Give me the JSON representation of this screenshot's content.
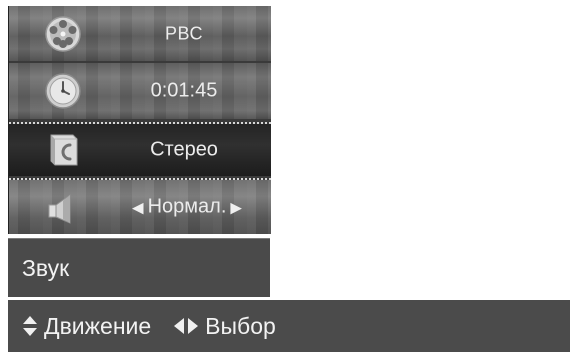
{
  "menu": {
    "items": [
      {
        "icon": "film-reel-icon",
        "label": "РВС"
      },
      {
        "icon": "clock-icon",
        "label": "0:01:45"
      },
      {
        "icon": "audio-track-icon",
        "label": "Стерео",
        "selected": true
      },
      {
        "icon": "speaker-icon",
        "label": "Нормал."
      }
    ]
  },
  "title": "Звук",
  "help": {
    "move_icon": "up-down-arrows-icon",
    "move_label": "Движение",
    "select_icon": "left-right-arrows-icon",
    "select_label": "Выбор"
  },
  "colors": {
    "panel": "#4b4b4b",
    "selected_row": "#242424",
    "text": "#ececec"
  }
}
